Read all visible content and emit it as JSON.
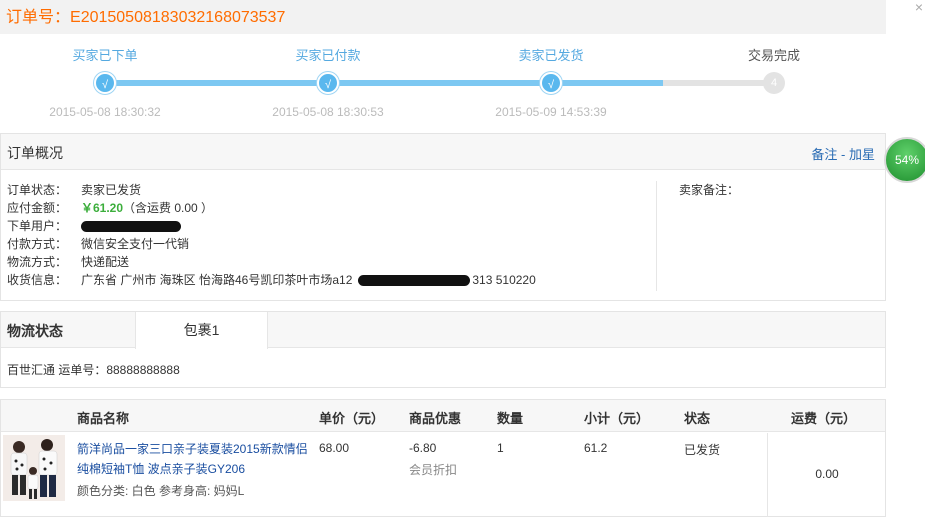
{
  "order": {
    "number_label": "订单号：",
    "number": "E2015050818303216807353​7"
  },
  "close_glyph": "×",
  "progress": {
    "steps": [
      {
        "label": "买家已下单",
        "time": "2015-05-08 18:30:32",
        "mark": "√"
      },
      {
        "label": "买家已付款",
        "time": "2015-05-08 18:30:53",
        "mark": "√"
      },
      {
        "label": "卖家已发货",
        "time": "2015-05-09 14:53:39",
        "mark": "√"
      },
      {
        "label": "交易完成",
        "time": "",
        "mark": "4"
      }
    ],
    "completed_steps": 3
  },
  "overview": {
    "title": "订单概况",
    "remark_link": "备注",
    "link_sep": " - ",
    "star_link": "加星",
    "rows": {
      "status": {
        "k": "订单状态：",
        "v": "卖家已发货"
      },
      "amount": {
        "k": "应付金额：",
        "price": "￥61.20",
        "extra": "（含运费 0.00 ）"
      },
      "user": {
        "k": "下单用户："
      },
      "pay": {
        "k": "付款方式：",
        "v": "微信安全支付一代销"
      },
      "ship": {
        "k": "物流方式：",
        "v": "快递配送"
      },
      "addr": {
        "k": "收货信息：",
        "v": "广东省 广州市 海珠区 怡海路46号凯印茶叶市场a12",
        "tail": "313 510220"
      }
    },
    "seller_remark_label": "卖家备注："
  },
  "badge": {
    "text": "54%"
  },
  "logistics": {
    "title": "物流状态",
    "tab": "包裹1",
    "waybill": "百世汇通 运单号：88888888888"
  },
  "goods": {
    "headers": {
      "name": "商品名称",
      "price": "单价（元）",
      "discount": "商品优惠",
      "qty": "数量",
      "subtotal": "小计（元）",
      "status": "状态",
      "shipfee": "运费（元）"
    },
    "item": {
      "name": "箭洋尚品一家三口亲子装夏装2015新款情侣纯棉短袖T恤 波点亲子装GY206",
      "sku": "颜色分类: 白色   参考身高: 妈妈L",
      "price": "68.00",
      "discount": "-6.80",
      "discount_note": "会员折扣",
      "qty": "1",
      "subtotal": "61.2",
      "status": "已发货"
    },
    "shipfee": "0.00"
  }
}
